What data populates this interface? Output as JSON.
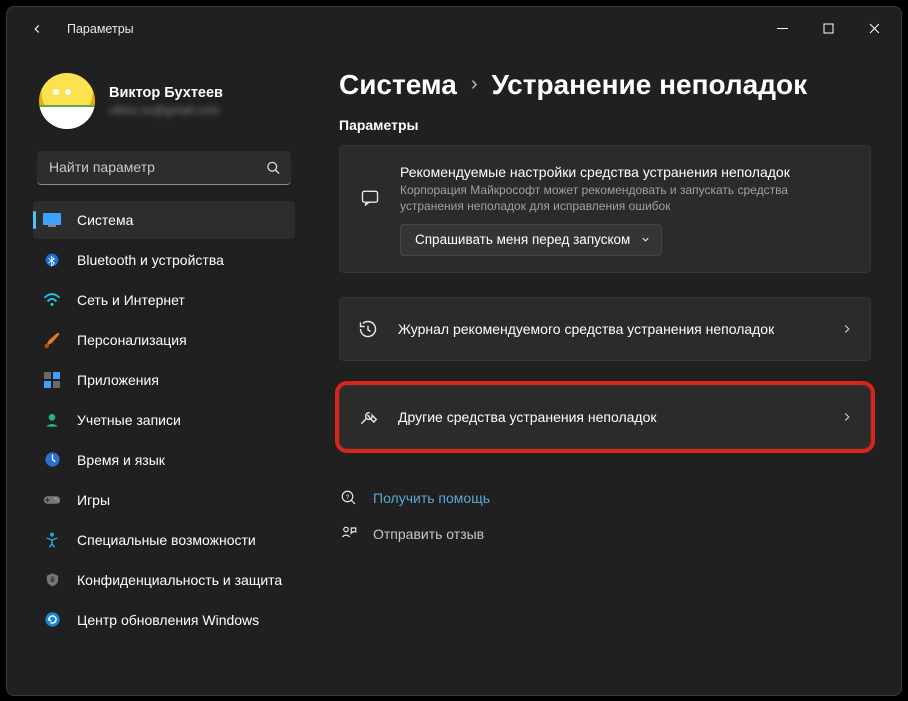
{
  "window": {
    "caption": "Параметры"
  },
  "profile": {
    "name": "Виктор Бухтеев",
    "email": "viktor.xx@gmail.com"
  },
  "search": {
    "placeholder": "Найти параметр"
  },
  "sidebar": {
    "items": [
      {
        "label": "Система"
      },
      {
        "label": "Bluetooth и устройства"
      },
      {
        "label": "Сеть и Интернет"
      },
      {
        "label": "Персонализация"
      },
      {
        "label": "Приложения"
      },
      {
        "label": "Учетные записи"
      },
      {
        "label": "Время и язык"
      },
      {
        "label": "Игры"
      },
      {
        "label": "Специальные возможности"
      },
      {
        "label": "Конфиденциальность и защита"
      },
      {
        "label": "Центр обновления Windows"
      }
    ]
  },
  "breadcrumb": {
    "root": "Система",
    "current": "Устранение неполадок"
  },
  "main": {
    "section_label": "Параметры",
    "recommended": {
      "title": "Рекомендуемые настройки средства устранения неполадок",
      "subtitle": "Корпорация Майкрософт может рекомендовать и запускать средства устранения неполадок для исправления ошибок",
      "dropdown_value": "Спрашивать меня перед запуском"
    },
    "history": {
      "title": "Журнал рекомендуемого средства устранения неполадок"
    },
    "other": {
      "title": "Другие средства устранения неполадок"
    }
  },
  "footer": {
    "help": "Получить помощь",
    "feedback": "Отправить отзыв"
  }
}
